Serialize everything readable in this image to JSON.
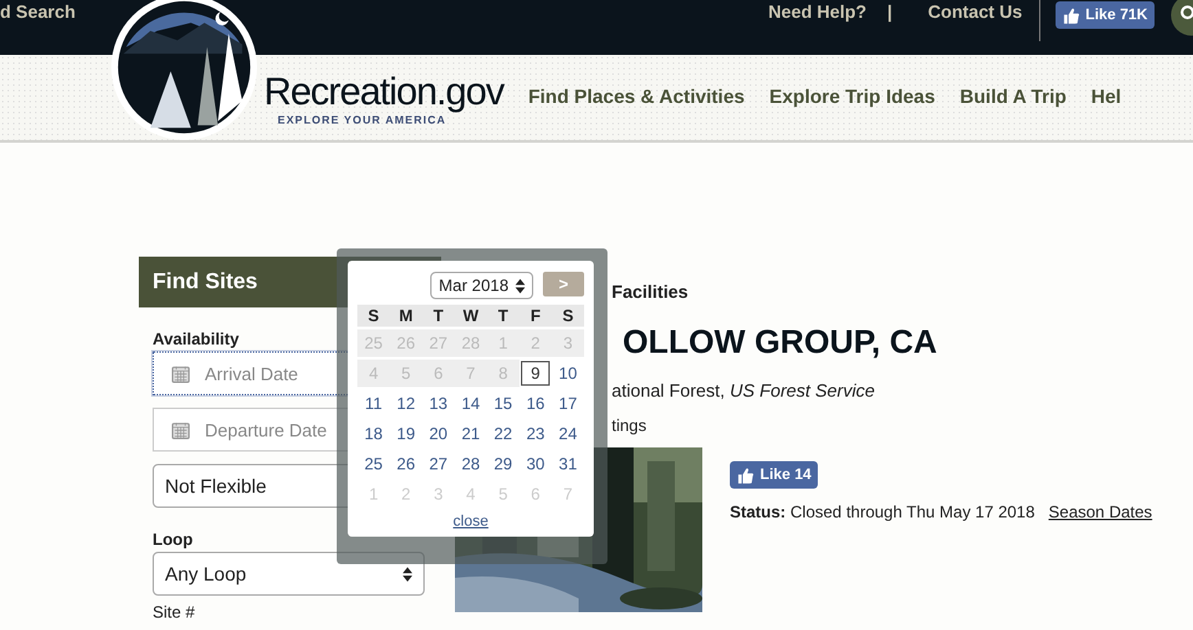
{
  "topbar": {
    "search_link": "d Search",
    "links": [
      {
        "label": "Need Help?",
        "kind": "link"
      },
      {
        "label": "|",
        "kind": "separator"
      },
      {
        "label": "Contact Us",
        "kind": "link"
      }
    ],
    "like": {
      "label": "Like",
      "count": "71K"
    }
  },
  "header": {
    "logo_title": "Recreation.gov",
    "logo_tagline": "EXPLORE YOUR AMERICA",
    "nav": [
      "Find Places & Activities",
      "Explore Trip Ideas",
      "Build A Trip",
      "Hel"
    ]
  },
  "find_sites": {
    "title": "Find Sites",
    "availability_label": "Availability",
    "arrival": {
      "placeholder": "Arrival Date",
      "focused": true
    },
    "departure": {
      "placeholder": "Departure Date",
      "focused": false
    },
    "flexibility": "Not Flexible",
    "loop_label": "Loop",
    "loop": "Any Loop",
    "site_label": "Site #"
  },
  "calendar": {
    "month": "Mar 2018",
    "next": ">",
    "weekdays": [
      "S",
      "M",
      "T",
      "W",
      "T",
      "F",
      "S"
    ],
    "days": [
      {
        "label": "25",
        "kind": "past",
        "selected": false
      },
      {
        "label": "26",
        "kind": "past",
        "selected": false
      },
      {
        "label": "27",
        "kind": "past",
        "selected": false
      },
      {
        "label": "28",
        "kind": "past",
        "selected": false
      },
      {
        "label": "1",
        "kind": "past",
        "selected": false
      },
      {
        "label": "2",
        "kind": "past",
        "selected": false
      },
      {
        "label": "3",
        "kind": "past",
        "selected": false
      },
      {
        "label": "4",
        "kind": "past",
        "selected": false
      },
      {
        "label": "5",
        "kind": "past",
        "selected": false
      },
      {
        "label": "6",
        "kind": "past",
        "selected": false
      },
      {
        "label": "7",
        "kind": "past",
        "selected": false
      },
      {
        "label": "8",
        "kind": "past",
        "selected": false
      },
      {
        "label": "9",
        "kind": "open",
        "selected": true
      },
      {
        "label": "10",
        "kind": "open",
        "selected": false
      },
      {
        "label": "11",
        "kind": "open",
        "selected": false
      },
      {
        "label": "12",
        "kind": "open",
        "selected": false
      },
      {
        "label": "13",
        "kind": "open",
        "selected": false
      },
      {
        "label": "14",
        "kind": "open",
        "selected": false
      },
      {
        "label": "15",
        "kind": "open",
        "selected": false
      },
      {
        "label": "16",
        "kind": "open",
        "selected": false
      },
      {
        "label": "17",
        "kind": "open",
        "selected": false
      },
      {
        "label": "18",
        "kind": "open",
        "selected": false
      },
      {
        "label": "19",
        "kind": "open",
        "selected": false
      },
      {
        "label": "20",
        "kind": "open",
        "selected": false
      },
      {
        "label": "21",
        "kind": "open",
        "selected": false
      },
      {
        "label": "22",
        "kind": "open",
        "selected": false
      },
      {
        "label": "23",
        "kind": "open",
        "selected": false
      },
      {
        "label": "24",
        "kind": "open",
        "selected": false
      },
      {
        "label": "25",
        "kind": "open",
        "selected": false
      },
      {
        "label": "26",
        "kind": "open",
        "selected": false
      },
      {
        "label": "27",
        "kind": "open",
        "selected": false
      },
      {
        "label": "28",
        "kind": "open",
        "selected": false
      },
      {
        "label": "29",
        "kind": "open",
        "selected": false
      },
      {
        "label": "30",
        "kind": "open",
        "selected": false
      },
      {
        "label": "31",
        "kind": "open",
        "selected": false
      },
      {
        "label": "1",
        "kind": "next",
        "selected": false
      },
      {
        "label": "2",
        "kind": "next",
        "selected": false
      },
      {
        "label": "3",
        "kind": "next",
        "selected": false
      },
      {
        "label": "4",
        "kind": "next",
        "selected": false
      },
      {
        "label": "5",
        "kind": "next",
        "selected": false
      },
      {
        "label": "6",
        "kind": "next",
        "selected": false
      },
      {
        "label": "7",
        "kind": "next",
        "selected": false
      }
    ],
    "close": "close"
  },
  "facility": {
    "breadcrumb": "Facilities",
    "title": "OLLOW GROUP, CA",
    "subtitle": "ational Forest, *US Forest Service*",
    "ratings": "tings",
    "like": {
      "label": "Like",
      "count": "14"
    },
    "status_label": "Status:",
    "status": "Closed through Thu May 17 2018",
    "season_link": "Season Dates"
  }
}
